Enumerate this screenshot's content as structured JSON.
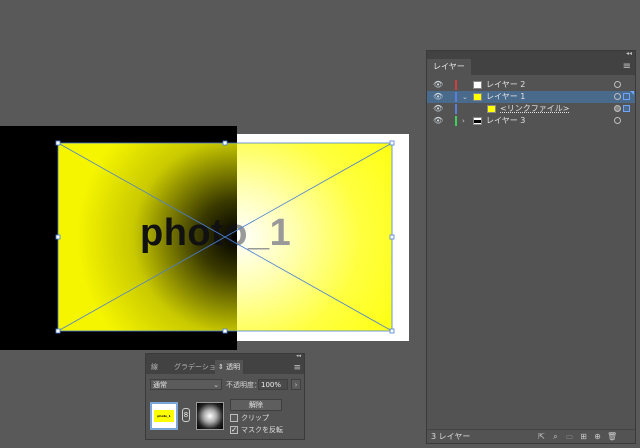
{
  "canvas": {
    "artwork_text": "photo_1",
    "selection_color": "#4a7fd4"
  },
  "layers_panel": {
    "tab_label": "レイヤー",
    "menu_icon": "hamburger-menu-icon",
    "collapse_icon": "double-chevron-icon",
    "layers": [
      {
        "name": "レイヤー 2",
        "color": "#d04040",
        "visible": true,
        "expanded": false,
        "thumb": "white"
      },
      {
        "name": "レイヤー 1",
        "color": "#5b7fd8",
        "visible": true,
        "expanded": true,
        "selected": true,
        "thumb": "yellow"
      },
      {
        "name": "<リンクファイル>",
        "color": "#5b7fd8",
        "visible": true,
        "sublayer": true,
        "thumb": "yellow"
      },
      {
        "name": "レイヤー 3",
        "color": "#3fcf5a",
        "visible": true,
        "expanded": false,
        "thumb": "black-white"
      }
    ],
    "footer": {
      "count_label": "3 レイヤー",
      "icons": [
        "export-icon",
        "search-icon",
        "clip-mask-icon",
        "new-sublayer-icon",
        "new-layer-icon",
        "delete-icon"
      ]
    }
  },
  "transparency_panel": {
    "tabs": [
      {
        "label": "線",
        "active": false
      },
      {
        "label": "グラデーション",
        "active": false
      },
      {
        "label": "透明",
        "active": true
      }
    ],
    "active_tab_prefix": "⇕",
    "blend_mode": "通常",
    "opacity_label": "不透明度：",
    "opacity_value": "100%",
    "art_thumb_text": "photo_1",
    "link_glyph": "8",
    "release_label": "解除",
    "clip_label": "クリップ",
    "clip_checked": false,
    "invert_label": "マスクを反転",
    "invert_checked": true
  }
}
